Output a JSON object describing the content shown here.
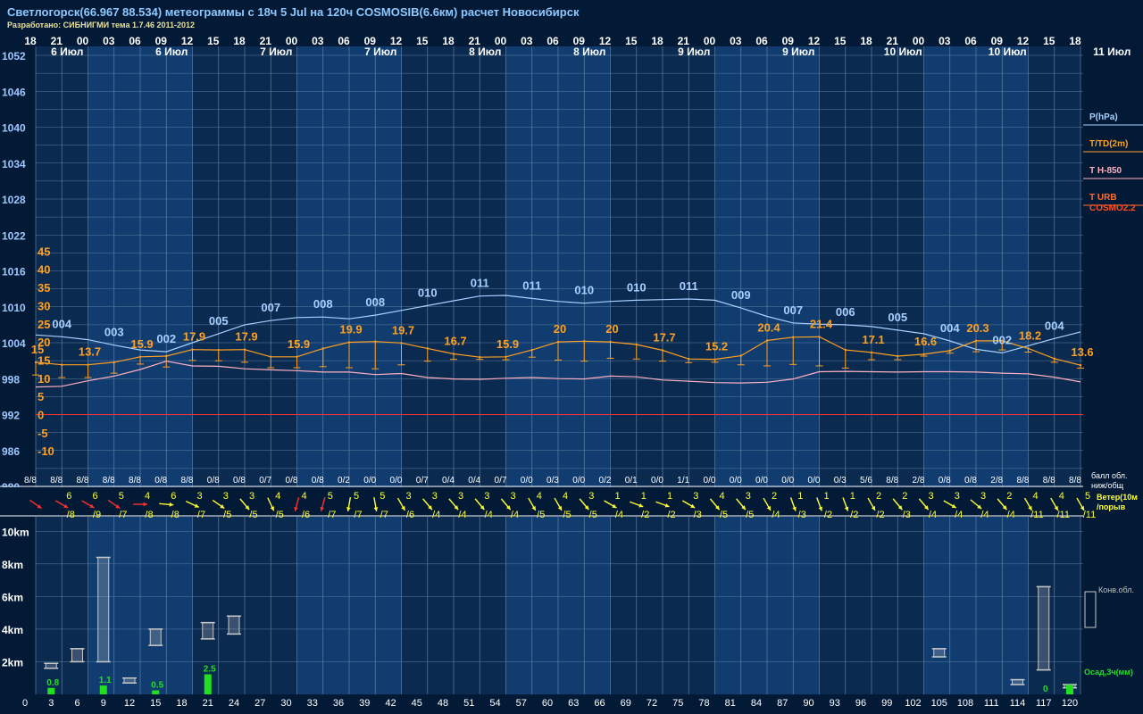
{
  "title": "Светлогорск(66.967 88.534) метеограммы с  18ч 5 Jul на 120ч COSMOSIB(6.6км) расчет Новосибирск",
  "subtitle": "Разработано: СИБНИГМИ тема 1.7.46 2011-2012",
  "colors": {
    "pressure": "#a8d0ff",
    "temp": "#ffa020",
    "t850": "#ffb0c0",
    "bg": "#0a2a50",
    "bgAlt": "#113c70",
    "grid": "#5e7ea2",
    "wind": "#ffff30",
    "windRed": "#ff3030",
    "precip": "#20e020",
    "cloud": "#c8c8c8",
    "zero": "#ff3030"
  },
  "hours_top": [
    "18",
    "21",
    "00",
    "03",
    "06",
    "09",
    "12",
    "15",
    "18",
    "21",
    "00",
    "03",
    "06",
    "09",
    "12",
    "15",
    "18",
    "21",
    "00",
    "03",
    "06",
    "09",
    "12",
    "15",
    "18",
    "21",
    "00",
    "03",
    "06",
    "09",
    "12",
    "15",
    "18",
    "21",
    "00",
    "03",
    "06",
    "09",
    "12",
    "15",
    "18"
  ],
  "day_labels": [
    {
      "slot": 1,
      "text": "6 Июл"
    },
    {
      "slot": 5,
      "text": "6 Июл"
    },
    {
      "slot": 9,
      "text": "7 Июл"
    },
    {
      "slot": 13,
      "text": "7 Июл"
    },
    {
      "slot": 17,
      "text": "8 Июл"
    },
    {
      "slot": 21,
      "text": "8 Июл"
    },
    {
      "slot": 25,
      "text": "9 Июл"
    },
    {
      "slot": 29,
      "text": "9 Июл"
    },
    {
      "slot": 33,
      "text": "10 Июл"
    },
    {
      "slot": 37,
      "text": "10 Июл"
    },
    {
      "slot": 41,
      "text": "11 Июл"
    }
  ],
  "legend": [
    {
      "text": "P(hPa)",
      "color": "#a8d0ff"
    },
    {
      "text": "T/TD(2m)",
      "color": "#ffa020"
    },
    {
      "text": "T H-850",
      "color": "#ffb0c0"
    },
    {
      "text": "T URB",
      "color": "#ff7030"
    },
    {
      "text": "COSMO2.2",
      "color": "#ff5020"
    }
  ],
  "chart_data": {
    "type": "line",
    "x_hours": [
      0,
      3,
      6,
      9,
      12,
      15,
      18,
      21,
      24,
      27,
      30,
      33,
      36,
      39,
      42,
      45,
      48,
      51,
      54,
      57,
      60,
      63,
      66,
      69,
      72,
      75,
      78,
      81,
      84,
      87,
      90,
      93,
      96,
      99,
      102,
      105,
      108,
      111,
      114,
      117,
      120
    ],
    "pressure_axis": {
      "ticks": [
        1052,
        1046,
        1040,
        1034,
        1028,
        1022,
        1016,
        1010,
        1004,
        998,
        992,
        986,
        980
      ],
      "range": [
        980,
        1052
      ]
    },
    "temp_axis": {
      "ticks": [
        45,
        40,
        35,
        30,
        25,
        20,
        15,
        10,
        5,
        0,
        -5,
        -10
      ],
      "range": [
        -12,
        48
      ]
    },
    "series": [
      {
        "name": "P(hPa)",
        "values": [
          1005.3,
          1005.0,
          1004.5,
          1003.6,
          1002.8,
          1002.5,
          1004.0,
          1005.5,
          1007.0,
          1007.7,
          1008.2,
          1008.3,
          1008.0,
          1008.6,
          1009.4,
          1010.2,
          1011.0,
          1011.8,
          1011.9,
          1011.4,
          1010.9,
          1010.6,
          1010.9,
          1011.1,
          1011.2,
          1011.3,
          1011.1,
          1009.8,
          1008.4,
          1007.3,
          1007.1,
          1007.0,
          1006.7,
          1006.1,
          1005.5,
          1004.3,
          1002.9,
          1002.3,
          1003.5,
          1004.7,
          1005.8
        ]
      },
      {
        "name": "T/TD(2m)",
        "values": [
          14.4,
          13.7,
          13.7,
          14.4,
          15.9,
          16.1,
          17.9,
          17.8,
          17.9,
          15.9,
          15.9,
          18.2,
          19.9,
          20.1,
          19.7,
          18.2,
          16.7,
          15.8,
          15.9,
          17.8,
          20.0,
          20.2,
          20.0,
          19.3,
          17.7,
          15.3,
          15.2,
          16.2,
          20.4,
          21.3,
          21.4,
          17.8,
          17.1,
          16.1,
          16.6,
          17.6,
          20.3,
          20.3,
          18.2,
          15.4,
          13.6
        ]
      },
      {
        "name": "T H-850",
        "values": [
          7.6,
          7.8,
          9.3,
          10.6,
          12.4,
          14.7,
          13.4,
          13.3,
          12.6,
          12.3,
          12.1,
          11.7,
          11.7,
          11.0,
          11.3,
          10.2,
          9.8,
          9.7,
          10.0,
          10.2,
          9.9,
          9.8,
          10.6,
          10.4,
          9.5,
          9.2,
          8.8,
          8.7,
          8.9,
          9.8,
          11.8,
          11.9,
          11.8,
          11.7,
          11.8,
          11.8,
          11.7,
          11.4,
          11.2,
          10.3,
          9.0
        ]
      }
    ],
    "temp_labels": [
      {
        "i": 0,
        "text": "15"
      },
      {
        "i": 2,
        "text": "13.7"
      },
      {
        "i": 4,
        "text": "15.9"
      },
      {
        "i": 6,
        "text": "17.9"
      },
      {
        "i": 8,
        "text": "17.9"
      },
      {
        "i": 10,
        "text": "15.9"
      },
      {
        "i": 12,
        "text": "19.9"
      },
      {
        "i": 14,
        "text": "19.7"
      },
      {
        "i": 16,
        "text": "16.7"
      },
      {
        "i": 18,
        "text": "15.9"
      },
      {
        "i": 20,
        "text": "20"
      },
      {
        "i": 22,
        "text": "20"
      },
      {
        "i": 24,
        "text": "17.7"
      },
      {
        "i": 26,
        "text": "15.2"
      },
      {
        "i": 28,
        "text": "20.4"
      },
      {
        "i": 30,
        "text": "21.4"
      },
      {
        "i": 32,
        "text": "17.1"
      },
      {
        "i": 34,
        "text": "16.6"
      },
      {
        "i": 36,
        "text": "20.3"
      },
      {
        "i": 38,
        "text": "18.2"
      },
      {
        "i": 40,
        "text": "13.6"
      }
    ],
    "pressure_labels": [
      {
        "i": 1,
        "text": "004"
      },
      {
        "i": 3,
        "text": "003"
      },
      {
        "i": 5,
        "text": "002"
      },
      {
        "i": 7,
        "text": "005"
      },
      {
        "i": 9,
        "text": "007"
      },
      {
        "i": 11,
        "text": "008"
      },
      {
        "i": 13,
        "text": "008"
      },
      {
        "i": 15,
        "text": "010"
      },
      {
        "i": 17,
        "text": "011"
      },
      {
        "i": 19,
        "text": "011"
      },
      {
        "i": 21,
        "text": "010"
      },
      {
        "i": 23,
        "text": "010"
      },
      {
        "i": 25,
        "text": "011"
      },
      {
        "i": 27,
        "text": "009"
      },
      {
        "i": 29,
        "text": "007"
      },
      {
        "i": 31,
        "text": "006"
      },
      {
        "i": 33,
        "text": "005"
      },
      {
        "i": 35,
        "text": "004"
      },
      {
        "i": 37,
        "text": "002"
      },
      {
        "i": 39,
        "text": "004"
      }
    ],
    "dewpoint_drop": [
      3.5,
      3.5,
      3.5,
      3.0,
      2.0,
      3.0,
      3.0,
      3.0,
      3.5,
      3.0,
      3.0,
      5.0,
      7.0,
      7.5,
      6.0,
      3.5,
      1.5,
      0.6,
      0.8,
      2.0,
      5.0,
      5.5,
      4.5,
      4.0,
      3.0,
      1.0,
      0.8,
      2.5,
      7.0,
      7.5,
      8.0,
      5.0,
      2.0,
      1.0,
      0.5,
      0.7,
      3.0,
      2.5,
      1.0,
      1.0,
      0.8
    ],
    "cloud_cover": [
      "8/8",
      "8/8",
      "8/8",
      "8/8",
      "8/8",
      "0/8",
      "8/8",
      "0/8",
      "0/8",
      "0/7",
      "0/8",
      "0/8",
      "0/2",
      "0/0",
      "0/0",
      "0/7",
      "0/4",
      "0/4",
      "0/7",
      "0/0",
      "0/3",
      "0/0",
      "0/2",
      "0/1",
      "0/0",
      "1/1",
      "0/0",
      "0/0",
      "0/0",
      "0/0",
      "0/0",
      "0/3",
      "5/6",
      "8/8",
      "2/8",
      "0/8",
      "0/8",
      "2/8",
      "8/8",
      "8/8",
      "8/8"
    ],
    "cloud_label": [
      "балл обл.",
      "ниж/общ"
    ],
    "wind_speed": [
      "",
      "6",
      "6",
      "5",
      "4",
      "6",
      "3",
      "3",
      "3",
      "4",
      "4",
      "5",
      "5",
      "5",
      "3",
      "3",
      "3",
      "3",
      "3",
      "4",
      "4",
      "3",
      "1",
      "1",
      "1",
      "3",
      "4",
      "3",
      "2",
      "1",
      "1",
      "1",
      "2",
      "2",
      "3",
      "3",
      "3",
      "2",
      "4",
      "4",
      "5"
    ],
    "wind_gust": [
      "",
      "/8",
      "/9",
      "/7",
      "/8",
      "/8",
      "/7",
      "/5",
      "/5",
      "/5",
      "/6",
      "/7",
      "/7",
      "/7",
      "/6",
      "/4",
      "/4",
      "/4",
      "/4",
      "/5",
      "/5",
      "/5",
      "/4",
      "/2",
      "/2",
      "/3",
      "/5",
      "/5",
      "/4",
      "/3",
      "/2",
      "/2",
      "/2",
      "/3",
      "/4",
      "/4",
      "/4",
      "/4",
      "/11",
      "/11",
      "/11"
    ],
    "wind_dir": [
      305,
      300,
      300,
      305,
      270,
      275,
      295,
      305,
      320,
      335,
      15,
      15,
      10,
      350,
      330,
      320,
      320,
      320,
      320,
      330,
      330,
      320,
      300,
      290,
      290,
      300,
      320,
      320,
      330,
      340,
      340,
      340,
      330,
      320,
      320,
      300,
      310,
      320,
      330,
      330,
      330
    ],
    "wind_label": [
      "Ветер(10м",
      "/порыв"
    ],
    "alt_axis": {
      "ticks": [
        "10km",
        "8km",
        "6km",
        "4km",
        "2km"
      ],
      "range_km": [
        0,
        11
      ]
    },
    "precip": [
      {
        "h": 3,
        "value": 0.8,
        "text": "0.8"
      },
      {
        "h": 9,
        "value": 1.1,
        "text": "1.1"
      },
      {
        "h": 15,
        "value": 0.5,
        "text": "0.5"
      },
      {
        "h": 21,
        "value": 2.5,
        "text": "2.5"
      },
      {
        "h": 117,
        "value": 0,
        "text": "0"
      },
      {
        "h": 120,
        "value": 1.2,
        "text": ""
      }
    ],
    "conv_clouds": [
      {
        "h": 3,
        "bot": 1.6,
        "top": 1.9
      },
      {
        "h": 6,
        "bot": 2.0,
        "top": 2.8
      },
      {
        "h": 9,
        "bot": 2.0,
        "top": 8.4
      },
      {
        "h": 12,
        "bot": 0.7,
        "top": 1.0
      },
      {
        "h": 15,
        "bot": 3.0,
        "top": 4.0
      },
      {
        "h": 21,
        "bot": 3.4,
        "top": 4.4
      },
      {
        "h": 24,
        "bot": 3.7,
        "top": 4.8
      },
      {
        "h": 105,
        "bot": 2.3,
        "top": 2.8
      },
      {
        "h": 114,
        "bot": 0.6,
        "top": 0.9
      },
      {
        "h": 117,
        "bot": 1.5,
        "top": 6.6
      },
      {
        "h": 120,
        "bot": 0.4,
        "top": 0.6
      }
    ],
    "conv_label": "Конв.обл.",
    "precip_label": "Осад,3ч(мм)",
    "hours_bottom": [
      "0",
      "3",
      "6",
      "9",
      "12",
      "15",
      "18",
      "21",
      "24",
      "27",
      "30",
      "33",
      "36",
      "39",
      "42",
      "45",
      "48",
      "51",
      "54",
      "57",
      "60",
      "63",
      "66",
      "69",
      "72",
      "75",
      "78",
      "81",
      "84",
      "87",
      "90",
      "93",
      "96",
      "99",
      "102",
      "105",
      "108",
      "111",
      "114",
      "117",
      "120"
    ]
  }
}
